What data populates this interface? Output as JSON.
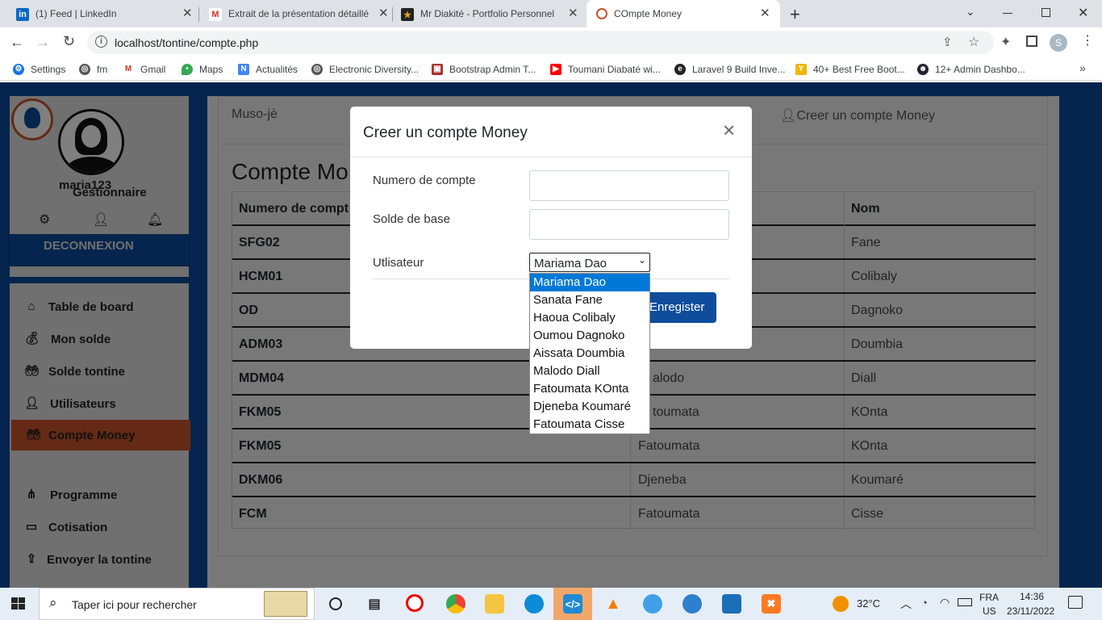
{
  "browser": {
    "tabs": [
      {
        "title": "(1) Feed | LinkedIn",
        "icon": "linkedin-icon"
      },
      {
        "title": "Extrait de la présentation détaillé",
        "icon": "gmail-icon"
      },
      {
        "title": "Mr Diakité - Portfolio Personnel",
        "icon": "star-icon"
      },
      {
        "title": "COmpte Money",
        "icon": "site-icon"
      }
    ],
    "new_tab": "+",
    "url": "localhost/tontine/compte.php",
    "profile_initial": "S",
    "bookmarks": [
      {
        "label": "Settings",
        "icon": "gear-icon"
      },
      {
        "label": "fm",
        "icon": "globe-icon"
      },
      {
        "label": "Gmail",
        "icon": "gmail-icon"
      },
      {
        "label": "Maps",
        "icon": "maps-icon"
      },
      {
        "label": "Actualités",
        "icon": "news-icon"
      },
      {
        "label": "Electronic Diversity...",
        "icon": "globe-icon"
      },
      {
        "label": "Bootstrap Admin T...",
        "icon": "bootstrap-icon"
      },
      {
        "label": "Toumani Diabaté wi...",
        "icon": "youtube-icon"
      },
      {
        "label": "Laravel 9 Build Inve...",
        "icon": "edge-icon"
      },
      {
        "label": "40+ Best Free Boot...",
        "icon": "bird-icon"
      },
      {
        "label": "12+ Admin Dashbo...",
        "icon": "ninja-icon"
      }
    ]
  },
  "sidebar": {
    "username": "maria123",
    "role": "Gestionnaire",
    "logout": "DECONNEXION",
    "items": [
      {
        "label": "Table de board",
        "icon": "home-icon",
        "active": false
      },
      {
        "label": "Mon solde",
        "icon": "moneybag-icon",
        "active": false
      },
      {
        "label": "Solde tontine",
        "icon": "hand-money-icon",
        "active": false
      },
      {
        "label": "Utilisateurs",
        "icon": "user-plus-icon",
        "active": false
      },
      {
        "label": "Compte Money",
        "icon": "hand-money-icon",
        "active": true
      },
      {
        "label": "Programme",
        "icon": "sitemap-icon",
        "active": false
      },
      {
        "label": "Cotisation",
        "icon": "card-icon",
        "active": false
      },
      {
        "label": "Envoyer la tontine",
        "icon": "send-money-icon",
        "active": false
      }
    ]
  },
  "content": {
    "brand": "Muso-jè",
    "create_account": "Creer un compte Money",
    "heading": "Compte Mo",
    "table": {
      "headers": [
        "Numero de compt",
        "Nom"
      ],
      "rows": [
        {
          "num": "SFG02",
          "prenom": "",
          "nom": "Fane"
        },
        {
          "num": "HCM01",
          "prenom": "",
          "nom": "Colibaly"
        },
        {
          "num": "OD",
          "prenom": "",
          "nom": "Dagnoko"
        },
        {
          "num": "ADM03",
          "prenom": "",
          "nom": "Doumbia"
        },
        {
          "num": "MDM04",
          "prenom": "alodo",
          "nom": "Diall"
        },
        {
          "num": "FKM05",
          "prenom": "toumata",
          "nom": "KOnta"
        },
        {
          "num": "FKM05",
          "prenom": "Fatoumata",
          "nom": "KOnta"
        },
        {
          "num": "DKM06",
          "prenom": "Djeneba",
          "nom": "Koumaré"
        },
        {
          "num": "FCM",
          "prenom": "Fatoumata",
          "nom": "Cisse"
        }
      ]
    }
  },
  "modal": {
    "title": "Creer un compte Money",
    "close": "×",
    "fields": {
      "account_label": "Numero de compte",
      "account_value": "",
      "balance_label": "Solde de base",
      "balance_value": "",
      "user_label": "Utlisateur",
      "user_selected": "Mariama Dao"
    },
    "save": "Enregister",
    "options": [
      "Mariama Dao",
      "Sanata Fane",
      "Haoua Colibaly",
      "Oumou Dagnoko",
      "Aissata Doumbia",
      "Malodo Diall",
      "Fatoumata KOnta",
      "Djeneba Koumaré",
      "Fatoumata Cisse"
    ]
  },
  "taskbar": {
    "search_placeholder": "Taper ici pour rechercher",
    "weather": "32°C",
    "lang_top": "FRA",
    "lang_bottom": "US",
    "time": "14:36",
    "date": "23/11/2022"
  },
  "colors": {
    "page_bg": "#0b4b9d",
    "active_menu": "#c9542d",
    "save_button": "#0d4d9c",
    "selected_option": "#0078d7"
  }
}
